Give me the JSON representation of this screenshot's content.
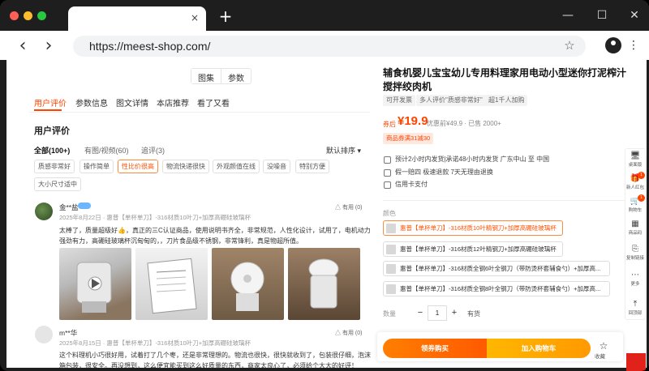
{
  "browser": {
    "tab_close": "×",
    "new_tab": "+",
    "url": "https://meest-shop.com/",
    "back": "‹",
    "forward": "›",
    "minimize": "—",
    "maximize": "☐",
    "close": "✕",
    "kebab": "⋮",
    "bookmark": "☆",
    "traffic_lights": [
      "#ff5f57",
      "#febc2e",
      "#28c840"
    ]
  },
  "gallery_toggle": [
    "图集",
    "参数"
  ],
  "detail_tabs": [
    "用户评价",
    "参数信息",
    "图文详情",
    "本店推荐",
    "看了又看"
  ],
  "reviews": {
    "heading": "用户评价",
    "filters": [
      "全部(100+)",
      "有图/视频(60)",
      "追评(3)"
    ],
    "sort": "默认排序 ▾",
    "chips": [
      "质感非常好",
      "操作简单",
      "性比价很高",
      "物流快递很快",
      "外观颜值在线",
      "没噪音",
      "特别方便",
      "大小尺寸适中"
    ],
    "items": [
      {
        "user": "金**盐",
        "date_sku": "2025年8月22日 · 惠普【单杯单刀】-316材质10叶刀+加厚高硼硅玻璃杯",
        "useful": "有用 (0)",
        "text": "太棒了，质量超级好👍，真正的三C认证商品，使用说明书齐全，非常规范，人性化设计，试用了，电机动力强劲有力，高硼硅玻璃杯沉甸甸的，，刀片食品级不锈钢，非常锋利，真是物超所值。"
      },
      {
        "user": "m**华",
        "date_sku": "2025年8月15日 · 惠普【单杯单刀】-316材质10叶刀+加厚高硼硅玻璃杯",
        "useful": "有用 (0)",
        "text": "这个料理机小巧很好用，试着打了几个枣，还是非常理想的。物流也很快，很快就收到了，包装很仔细，泡沫箱包装，很安全。再没想到，这么便宜能买到这么好质量的东西，商家太良心了，必须给个大大的好评！"
      }
    ]
  },
  "product": {
    "title": "辅食机婴儿宝宝幼儿专用料理家用电动小型迷你打泥榨汁搅拌绞肉机",
    "tags": [
      "可开发票",
      "多人评价\"质感非常好\"",
      "超1千人加购"
    ],
    "price_label": "券后",
    "price": "¥19.9",
    "old_price": "优惠前¥49.9 · 已售 2000+",
    "coupon": "商品券满31减30",
    "services": [
      "预计2小时内发货|承诺48小时内发货  广东中山 至 中国",
      "假一赔四   极速退款   7天无理由退换",
      "信用卡支付"
    ],
    "color_label": "颜色",
    "options": [
      "惠普【单杯单刀】-316材质10叶精钢刀+加厚高硼硅玻璃杯",
      "惠普【单杯单刀】-316材质12叶精钢刀+加厚高硼硅玻璃杯",
      "惠普【单杯单刀】-316材质全钢6叶全钢刀（带防烫杯套辅食勺）+加厚高...",
      "惠普【单杯单刀】-316材质全钢8叶全钢刀（带防烫杯套辅食勺）+加厚高..."
    ],
    "qty_label": "数量",
    "qty": "1",
    "qty_minus": "−",
    "qty_plus": "+",
    "stock": "有货",
    "buy_now": "领券购买",
    "add_cart": "加入购物车",
    "fav_label": "收藏",
    "fav_icon": "☆"
  },
  "rail": [
    {
      "icon": "🖥",
      "label": "桌面版"
    },
    {
      "icon": "🎁",
      "label": "新人红包",
      "badge": "1"
    },
    {
      "icon": "🛒",
      "label": "购物车",
      "badge": "1"
    },
    {
      "icon": "▦",
      "label": "商品码"
    },
    {
      "icon": "⎘",
      "label": "复制链接"
    },
    {
      "icon": "⋯",
      "label": "更多"
    },
    {
      "icon": "⤒",
      "label": "回顶部"
    }
  ]
}
